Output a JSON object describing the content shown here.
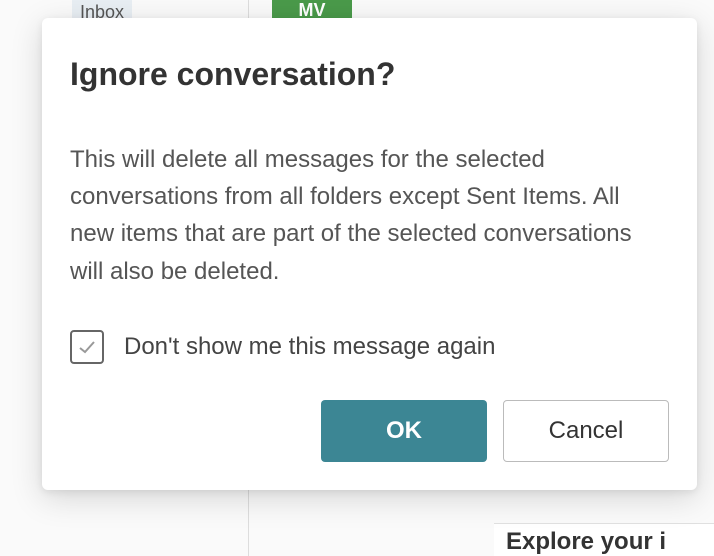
{
  "background": {
    "inbox_label": "Inbox",
    "avatar_initials": "MV",
    "explore_text": "Explore your i"
  },
  "dialog": {
    "title": "Ignore conversation?",
    "body": "This will delete all messages for the selected conversations from all folders except Sent Items. All new items that are part of the selected conversations will also be deleted.",
    "checkbox_label": "Don't show me this message again",
    "ok_label": "OK",
    "cancel_label": "Cancel"
  }
}
